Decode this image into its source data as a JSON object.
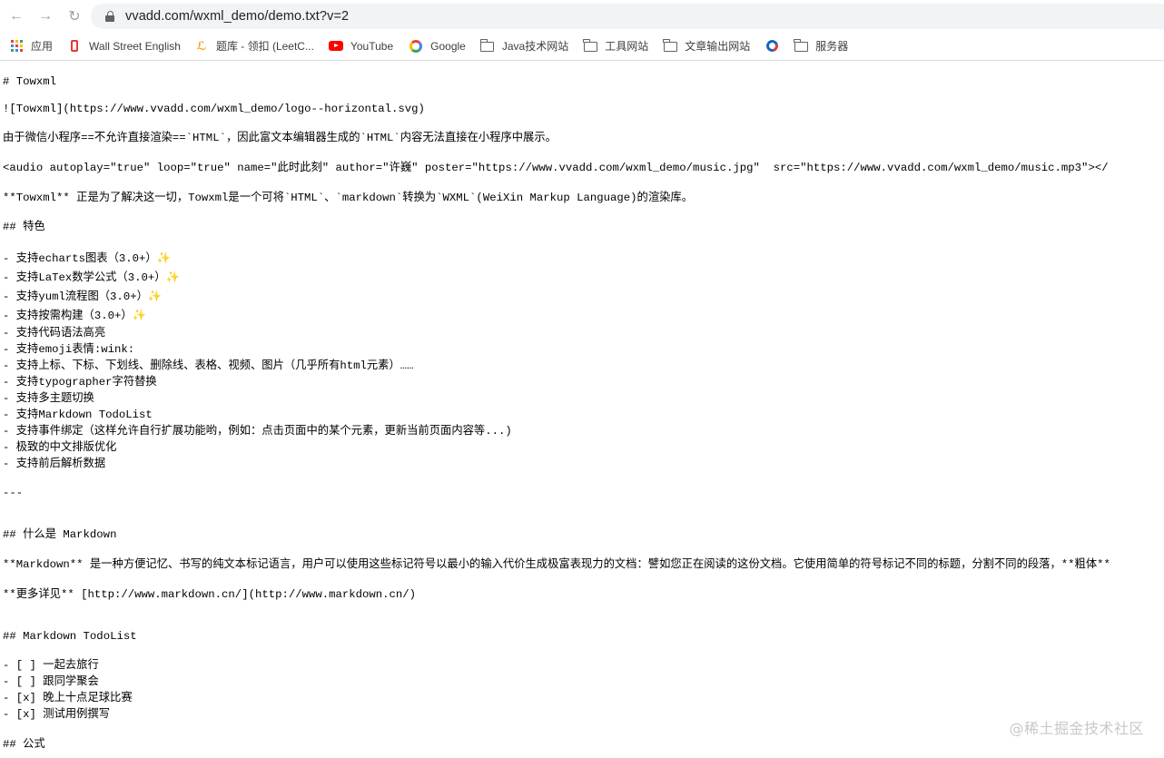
{
  "browser": {
    "url": "vvadd.com/wxml_demo/demo.txt?v=2",
    "back_icon": "←",
    "forward_icon": "→",
    "reload_icon": "↻"
  },
  "bookmarks": [
    {
      "label": "应用",
      "icon": "apps-grid-icon"
    },
    {
      "label": "Wall Street English",
      "icon": "wse-icon"
    },
    {
      "label": "题库 - 领扣 (LeetC...",
      "icon": "leetcode-icon"
    },
    {
      "label": "YouTube",
      "icon": "youtube-icon"
    },
    {
      "label": "Google",
      "icon": "google-icon"
    },
    {
      "label": "Java技术网站",
      "icon": "folder-icon"
    },
    {
      "label": "工具网站",
      "icon": "folder-icon"
    },
    {
      "label": "文章输出网站",
      "icon": "folder-icon"
    },
    {
      "label": "",
      "icon": "swirl-icon"
    },
    {
      "label": "服务器",
      "icon": "folder-icon"
    }
  ],
  "document": {
    "lines": [
      "# Towxml",
      "![Towxml](https://www.vvadd.com/wxml_demo/logo--horizontal.svg)",
      "由于微信小程序==不允许直接渲染==`HTML`，因此富文本编辑器生成的`HTML`内容无法直接在小程序中展示。",
      "<audio autoplay=\"true\" loop=\"true\" name=\"此时此刻\" author=\"许巍\" poster=\"https://www.vvadd.com/wxml_demo/music.jpg\"  src=\"https://www.vvadd.com/wxml_demo/music.mp3\"></",
      "**Towxml** 正是为了解决这一切，Towxml是一个可将`HTML`、`markdown`转换为`WXML`(WeiXin Markup Language)的渲染库。",
      "## 特色",
      "- 支持echarts图表（3.0+）✨",
      "- 支持LaTex数学公式（3.0+）✨",
      "- 支持yuml流程图（3.0+）✨",
      "- 支持按需构建（3.0+）✨",
      "- 支持代码语法高亮",
      "- 支持emoji表情:wink:",
      "- 支持上标、下标、下划线、删除线、表格、视频、图片（几乎所有html元素）……",
      "- 支持typographer字符替换",
      "- 支持多主题切换",
      "- 支持Markdown TodoList",
      "- 支持事件绑定（这样允许自行扩展功能哟，例如：点击页面中的某个元素，更新当前页面内容等...)",
      "- 极致的中文排版优化",
      "- 支持前后解析数据",
      "---",
      "## 什么是 Markdown",
      "**Markdown** 是一种方便记忆、书写的纯文本标记语言，用户可以使用这些标记符号以最小的输入代价生成极富表现力的文档：譬如您正在阅读的这份文档。它使用简单的符号标记不同的标题，分割不同的段落，**粗体**",
      "**更多详见** [http://www.markdown.cn/](http://www.markdown.cn/)",
      "## Markdown TodoList",
      "- [ ] 一起去旅行",
      "- [ ] 跟同学聚会",
      "- [x] 晚上十点足球比赛",
      "- [x] 测试用例撰写",
      "## 公式"
    ]
  },
  "watermark": "@稀土掘金技术社区"
}
